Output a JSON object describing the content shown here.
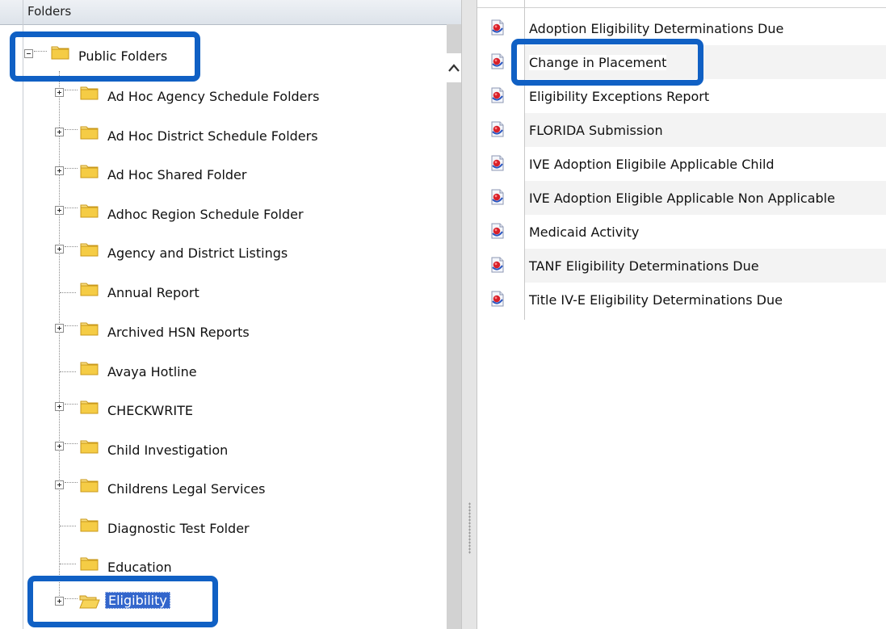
{
  "folders_pane": {
    "header": "Folders",
    "root": {
      "label": "Public Folders",
      "expanded": true
    },
    "items": [
      {
        "label": "Ad Hoc Agency Schedule Folders",
        "expandable": true
      },
      {
        "label": "Ad Hoc District Schedule Folders",
        "expandable": true
      },
      {
        "label": "Ad Hoc Shared Folder",
        "expandable": true
      },
      {
        "label": "Adhoc Region Schedule Folder",
        "expandable": true
      },
      {
        "label": "Agency and District Listings",
        "expandable": true
      },
      {
        "label": "Annual Report",
        "expandable": false
      },
      {
        "label": "Archived HSN Reports",
        "expandable": true
      },
      {
        "label": "Avaya Hotline",
        "expandable": false
      },
      {
        "label": "CHECKWRITE",
        "expandable": true
      },
      {
        "label": "Child Investigation",
        "expandable": true
      },
      {
        "label": "Childrens Legal Services",
        "expandable": true
      },
      {
        "label": "Diagnostic Test Folder",
        "expandable": false
      },
      {
        "label": "Education",
        "expandable": false
      },
      {
        "label": "Eligibility",
        "expandable": true,
        "selected": true,
        "open": true
      }
    ]
  },
  "reports_pane": {
    "items": [
      {
        "label": "Adoption Eligibility Determinations Due"
      },
      {
        "label": "Change in Placement",
        "highlighted": true
      },
      {
        "label": "Eligibility Exceptions Report"
      },
      {
        "label": "FLORIDA Submission"
      },
      {
        "label": "IVE Adoption Eligibile Applicable Child"
      },
      {
        "label": "IVE Adoption Eligible Applicable Non Applicable"
      },
      {
        "label": "Medicaid Activity"
      },
      {
        "label": "TANF Eligibility Determinations Due"
      },
      {
        "label": "Title IV-E Eligibility Determinations Due"
      }
    ]
  },
  "icons": {
    "folder": "folder-icon",
    "open_folder": "open-folder-icon",
    "report": "report-document-icon",
    "scroll_up": "chevron-up-icon"
  },
  "colors": {
    "callout": "#1060c4",
    "selection": "#3366cc",
    "folder_yellow": "#f3c93b"
  }
}
